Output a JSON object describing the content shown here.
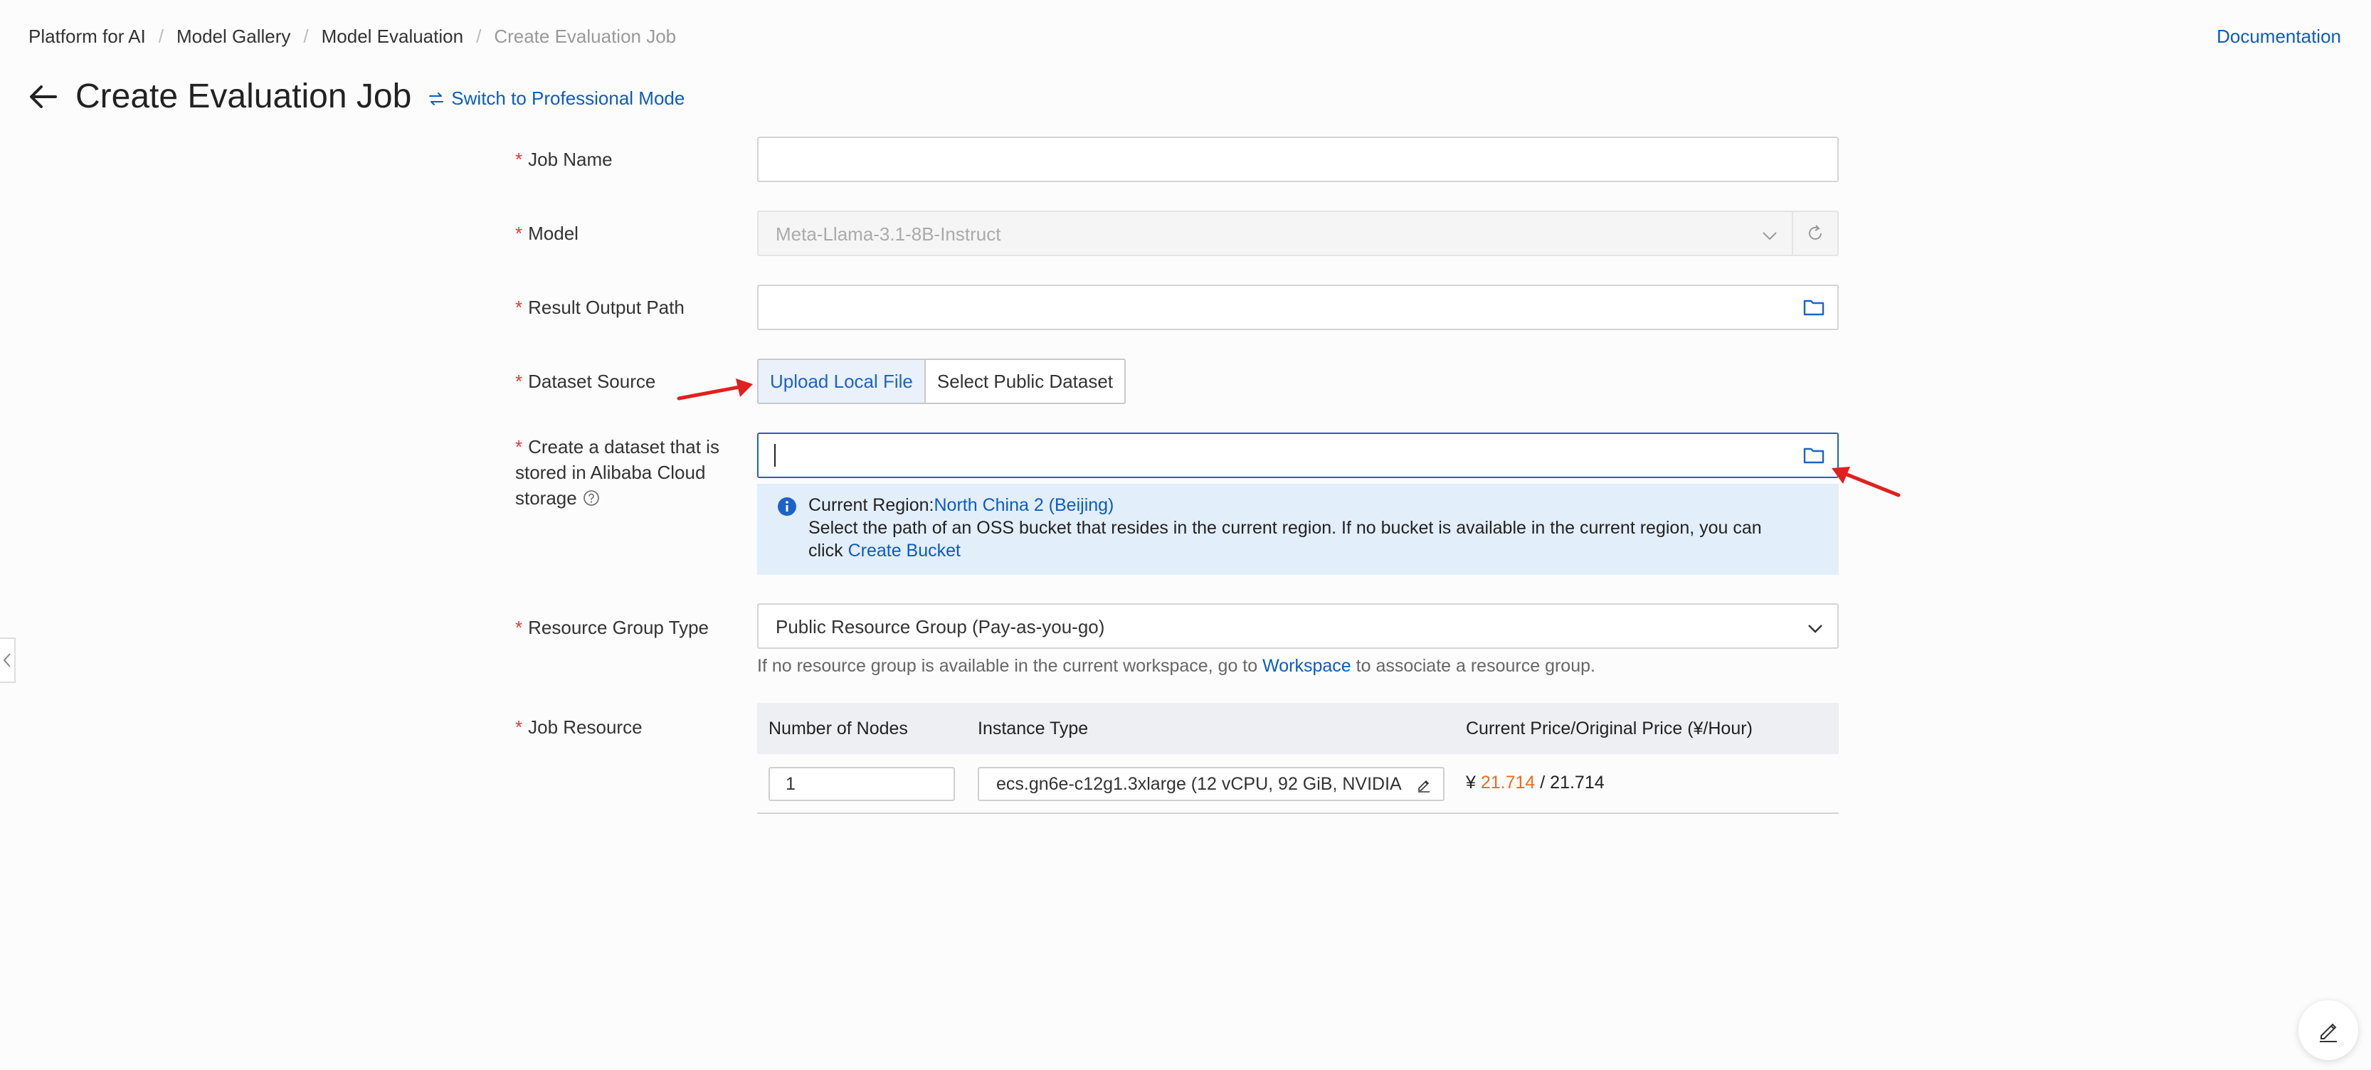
{
  "breadcrumb": {
    "items": [
      "Platform for AI",
      "Model Gallery",
      "Model Evaluation"
    ],
    "current": "Create Evaluation Job"
  },
  "header": {
    "doc_link": "Documentation",
    "title": "Create Evaluation Job",
    "switch_mode": "Switch to Professional Mode"
  },
  "form": {
    "job_name": {
      "label": "Job Name",
      "value": ""
    },
    "model": {
      "label": "Model",
      "value": "Meta-Llama-3.1-8B-Instruct"
    },
    "result_path": {
      "label": "Result Output Path",
      "value": ""
    },
    "dataset_source": {
      "label": "Dataset Source",
      "options": [
        "Upload Local File",
        "Select Public Dataset"
      ],
      "selected": "Upload Local File"
    },
    "oss_dataset": {
      "label_lines": [
        "Create a dataset that is",
        "stored in Alibaba Cloud",
        "storage"
      ],
      "value": ""
    },
    "info": {
      "prefix": "Current Region:",
      "region": "North China 2 (Beijing)",
      "line2": "Select the path of an OSS bucket that resides in the current region. If no bucket is available in the current region, you can",
      "line3_prefix": "click ",
      "line3_link": "Create Bucket"
    },
    "resource_group": {
      "label": "Resource Group Type",
      "value": "Public Resource Group (Pay-as-you-go)",
      "hint_prefix": "If no resource group is available in the current workspace, go to ",
      "hint_link": "Workspace",
      "hint_suffix": " to associate a resource group."
    },
    "job_resource": {
      "label": "Job Resource",
      "columns": [
        "Number of Nodes",
        "Instance Type",
        "Current Price/Original Price (¥/Hour)"
      ],
      "nodes": "1",
      "instance": "ecs.gn6e-c12g1.3xlarge  (12 vCPU, 92 GiB, NVIDIA",
      "currency": "¥ ",
      "price_current": "21.714",
      "price_sep": " / ",
      "price_original": "21.714"
    }
  },
  "colors": {
    "accent": "#1c63c9",
    "link": "#0b5cc2",
    "required": "#e23c2f",
    "price": "#ef6b1c",
    "annotation": "#e02020"
  }
}
